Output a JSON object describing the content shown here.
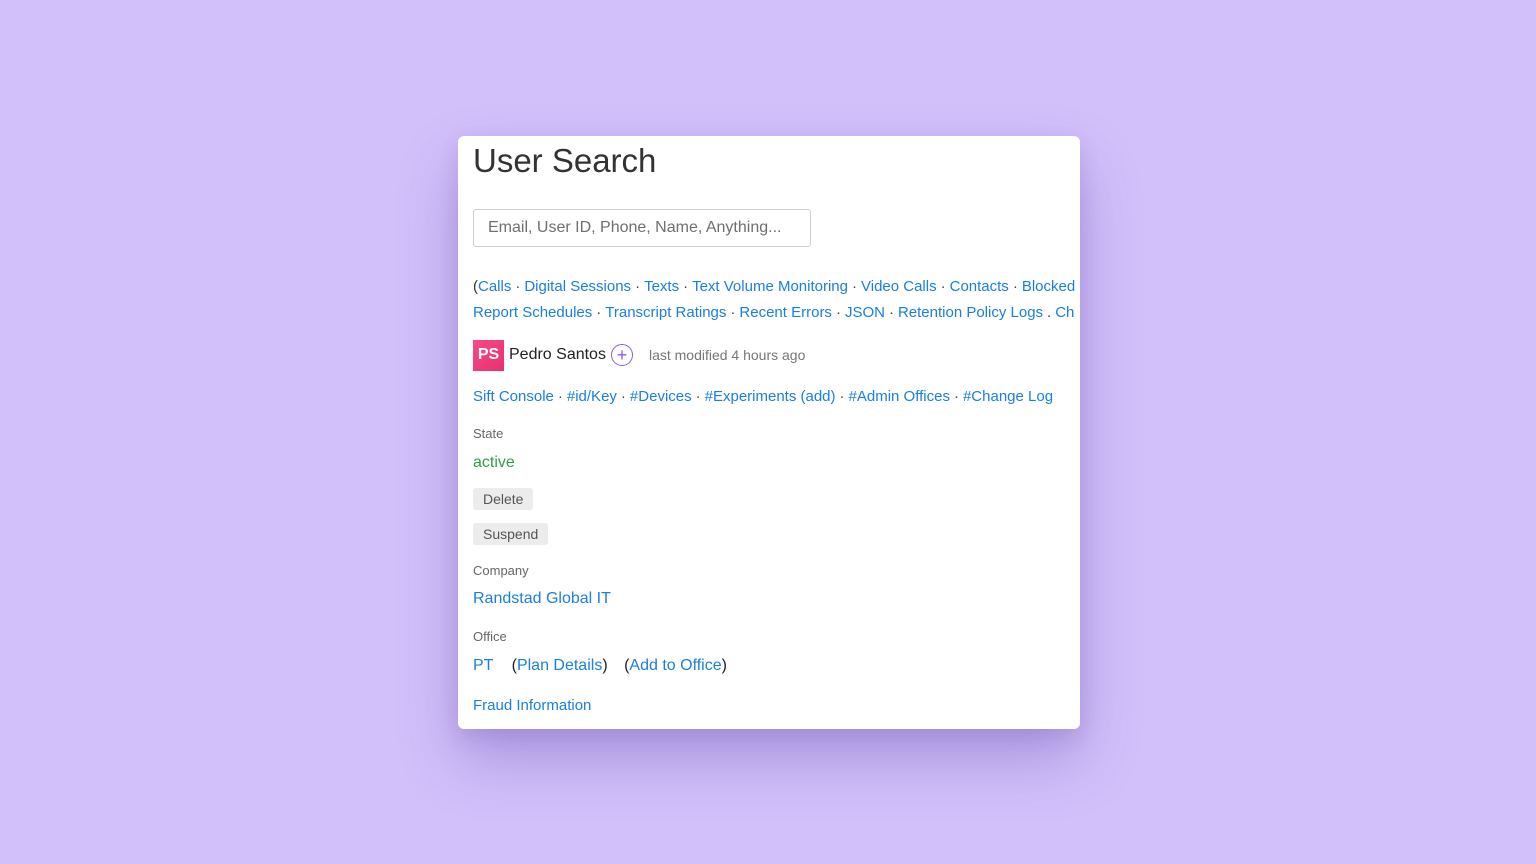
{
  "page": {
    "title": "User Search"
  },
  "search": {
    "placeholder": "Email, User ID, Phone, Name, Anything...",
    "value": ""
  },
  "nav": {
    "open_paren": "(",
    "line1": [
      "Calls",
      "Digital Sessions",
      "Texts",
      "Text Volume Monitoring",
      "Video Calls",
      "Contacts",
      "Blocked"
    ],
    "line2": [
      "Report Schedules",
      "Transcript Ratings",
      "Recent Errors",
      "JSON",
      "Retention Policy Logs",
      "Ch"
    ],
    "separator": "·",
    "alt_separator": "."
  },
  "user": {
    "initials": "PS",
    "name": "Pedro Santos",
    "add_symbol": "+",
    "last_modified": "last modified 4 hours ago"
  },
  "user_links": [
    "Sift Console",
    "#id/Key",
    "#Devices",
    "#Experiments (add)",
    "#Admin Offices",
    "#Change Log"
  ],
  "state": {
    "label": "State",
    "value": "active",
    "delete_label": "Delete",
    "suspend_label": "Suspend"
  },
  "company": {
    "label": "Company",
    "value": "Randstad Global IT"
  },
  "office": {
    "label": "Office",
    "code": "PT",
    "plan_details": "Plan Details",
    "add_to_office": "Add to Office",
    "open_paren": "(",
    "close_paren": ")"
  },
  "fraud": {
    "label": "Fraud Information"
  },
  "colors": {
    "background": "#d2c0fb",
    "link": "#1a7fe0",
    "active": "#2ea044",
    "avatar": "#e8306a",
    "accent": "#8a5cf0"
  }
}
